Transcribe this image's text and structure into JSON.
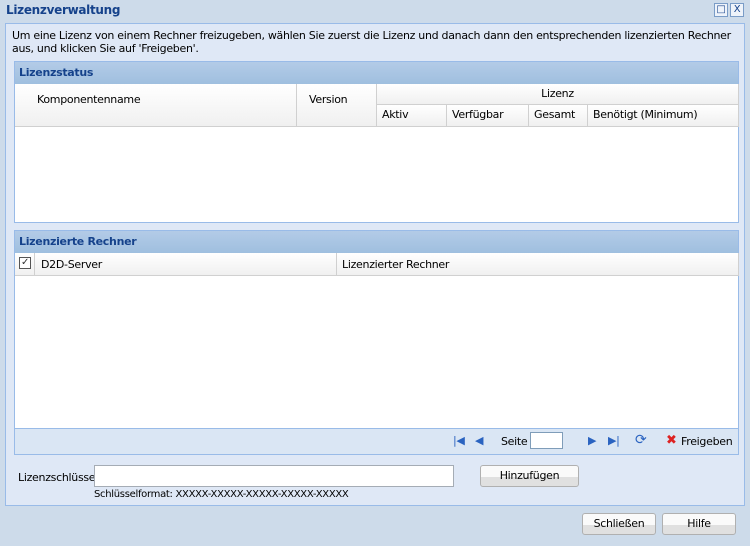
{
  "window": {
    "title": "Lizenzverwaltung",
    "maximize_icon": "□",
    "close_icon": "X"
  },
  "intro": "Um eine Lizenz von einem Rechner freizugeben, wählen Sie zuerst die Lizenz und danach dann den entsprechenden lizenzierten Rechner aus, und klicken Sie auf 'Freigeben'.",
  "status_panel": {
    "title": "Lizenzstatus",
    "columns": {
      "name": "Komponentenname",
      "version": "Version",
      "license": "Lizenz",
      "active": "Aktiv",
      "available": "Verfügbar",
      "total": "Gesamt",
      "required": "Benötigt (Minimum)"
    }
  },
  "machines_panel": {
    "title": "Lizenzierte Rechner",
    "columns": {
      "server": "D2D-Server",
      "machine": "Lizenzierter Rechner"
    },
    "checkbox_checked": true,
    "toolbar": {
      "page_label": "Seite",
      "page_value": "",
      "release": "Freigeben"
    }
  },
  "key": {
    "label": "Lizenzschlüssel",
    "value": "",
    "format": "Schlüsselformat: XXXXX-XXXXX-XXXXX-XXXXX-XXXXX",
    "add": "Hinzufügen"
  },
  "footer": {
    "close": "Schließen",
    "help": "Hilfe"
  }
}
